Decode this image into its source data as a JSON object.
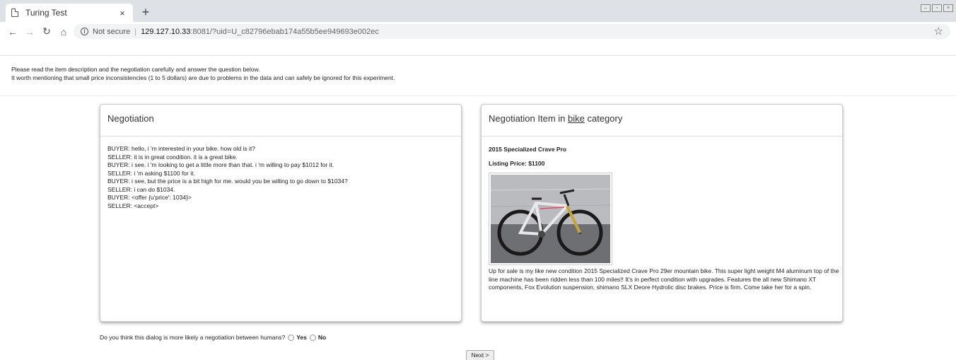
{
  "browser": {
    "tab_title": "Turing Test",
    "tab_close": "×",
    "new_tab": "+",
    "not_secure": "Not secure",
    "url_host": "129.127.10.33",
    "url_rest": ":8081/?uid=U_c82796ebab174a55b5ee949693e002ec"
  },
  "instructions": {
    "line1": "Please read the item description and the negotiation carefully and answer the question below.",
    "line2": "It worth mentioning that small price inconsistencies (1 to 5 dollars) are due to problems in the data and can safely be ignored for this experiment."
  },
  "negotiation": {
    "heading": "Negotiation",
    "lines": [
      "BUYER: hello, i 'm interested in your bike. how old is it?",
      "SELLER: it is in great condition. it is a great bike.",
      "BUYER: i see. i 'm looking to get a little more than that. i 'm willing to pay $1012 for it.",
      "SELLER: i 'm asking $1100 for it.",
      "BUYER: i see, but the price is a bit high for me. would you be willing to go down to $1034?",
      "SELLER: i can do $1034.",
      "BUYER: <offer {u'price': 1034}>",
      "SELLER: <accept>"
    ]
  },
  "item": {
    "heading_prefix": "Negotiation Item in ",
    "category": "bike",
    "heading_suffix": " category",
    "title": "2015 Specialized Crave Pro",
    "listing_price": "Listing Price: $1100",
    "description": "Up for sale is my like new condition 2015 Specialized Crave Pro 29er mountain bike. This super light weight M4 aluminum top of the line machine has been ridden less than 100 miles!! It's in perfect condition with upgrades. Features the all new Shimano XT components, Fox Evolution suspension, shimano SLX Deore Hydrolic disc brakes. Price is firm. Come take her for a spin."
  },
  "question": {
    "text": "Do you think this dialog is more likely a negotiation between humans?",
    "yes": "Yes",
    "no": "No"
  },
  "next_button": "Next >"
}
